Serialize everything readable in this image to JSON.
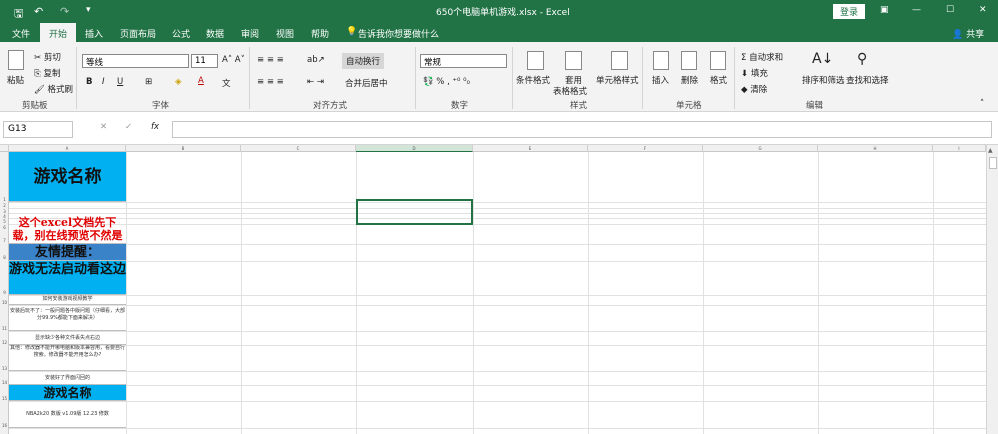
{
  "window": {
    "title": "650个电脑单机游戏.xlsx  -  Excel",
    "login": "登录",
    "share": "共享"
  },
  "tabs": [
    "文件",
    "开始",
    "插入",
    "页面布局",
    "公式",
    "数据",
    "审阅",
    "视图",
    "帮助"
  ],
  "tell_me": "告诉我你想要做什么",
  "ribbon": {
    "paste": "粘贴",
    "cut": "剪切",
    "copy": "复制",
    "format_painter": "格式刷",
    "clipboard": "剪贴板",
    "font_name": "等线",
    "font_size": "11",
    "font_group": "字体",
    "wrap": "自动换行",
    "merge": "合并后居中",
    "align_group": "对齐方式",
    "number_format": "常规",
    "number_group": "数字",
    "cond_format": "条件格式",
    "table_format_1": "套用",
    "table_format_2": "表格格式",
    "cell_style": "单元格样式",
    "style_group": "样式",
    "insert": "插入",
    "delete": "删除",
    "format": "格式",
    "cells_group": "单元格",
    "autosum": "自动求和",
    "fill": "填充",
    "clear": "清除",
    "sort": "排序和筛选",
    "find": "查找和选择",
    "edit_group": "编辑"
  },
  "formula_bar": {
    "name_box": "G13",
    "fx": "fx",
    "value": ""
  },
  "columns": [
    "A",
    "B",
    "C",
    "D",
    "E",
    "F",
    "G",
    "H",
    "I"
  ],
  "rows": [
    "1",
    "2",
    "3",
    "4",
    "5",
    "6",
    "7",
    "8",
    "9",
    "10",
    "11",
    "12",
    "13",
    "14",
    "15",
    "16",
    "17"
  ],
  "cells": {
    "a1": "游戏名称",
    "a7": "这个excel文档先下载，别在线预览不然是",
    "a8": "友情提醒：",
    "a9": "游戏无法启动看这边",
    "a10": "如何安装游戏视频教学",
    "a11": "安装后玩不了：一般问题各中版问题（仔细看，大部分99.9%都能下面来解决）",
    "a12": "显示缺少各种文件丢失点右边",
    "a13": "其他：修改器不能开哪电脑和版本兼容用，看要自行搜索。修改器不能开用怎么办?",
    "a14": "安装好了界面闪回的",
    "a15": "游戏名称",
    "a16": "NBA2k20 数版 v1.09版 12.23 修数"
  }
}
